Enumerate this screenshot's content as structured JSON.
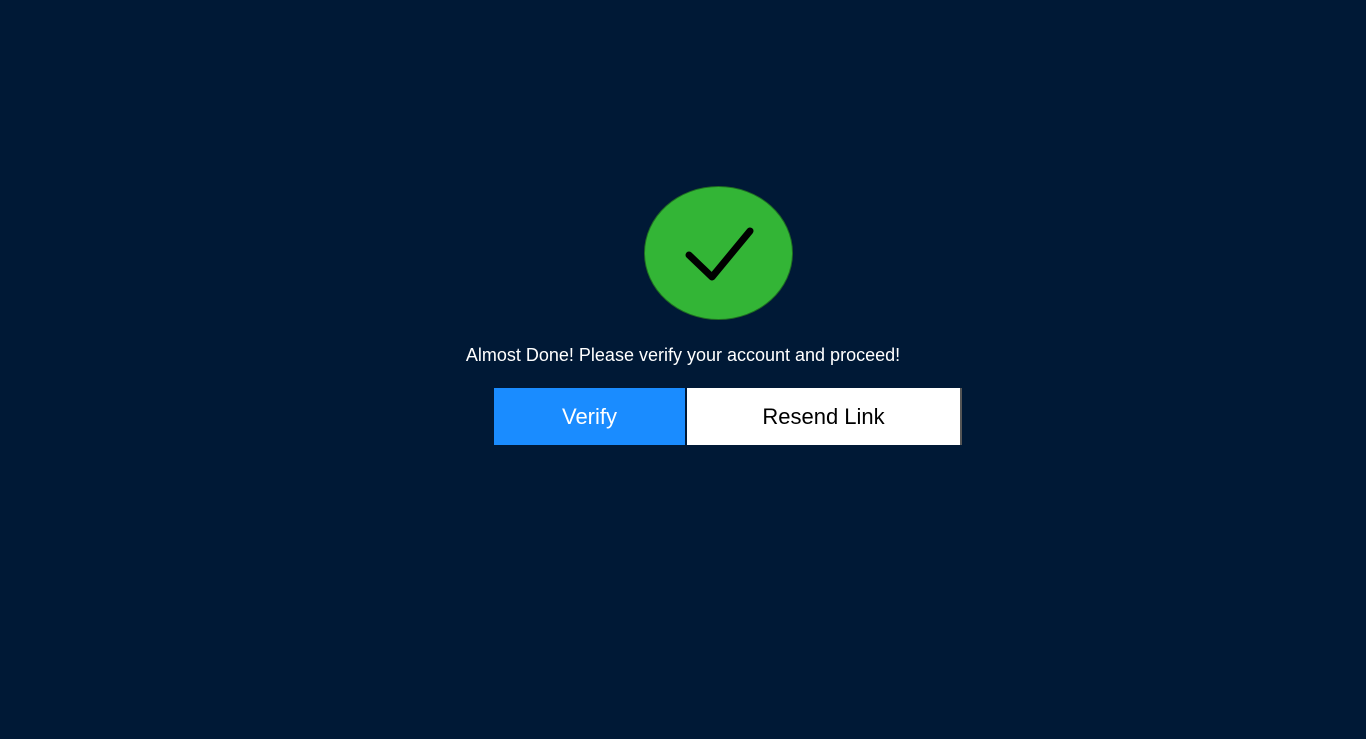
{
  "status": {
    "icon": "checkmark-icon",
    "icon_color": "#33b536",
    "message": "Almost Done! Please verify your account and proceed!"
  },
  "actions": {
    "verify_label": "Verify",
    "verify_color": "#1a8cff",
    "resend_label": "Resend Link"
  },
  "theme": {
    "background": "#001936"
  }
}
